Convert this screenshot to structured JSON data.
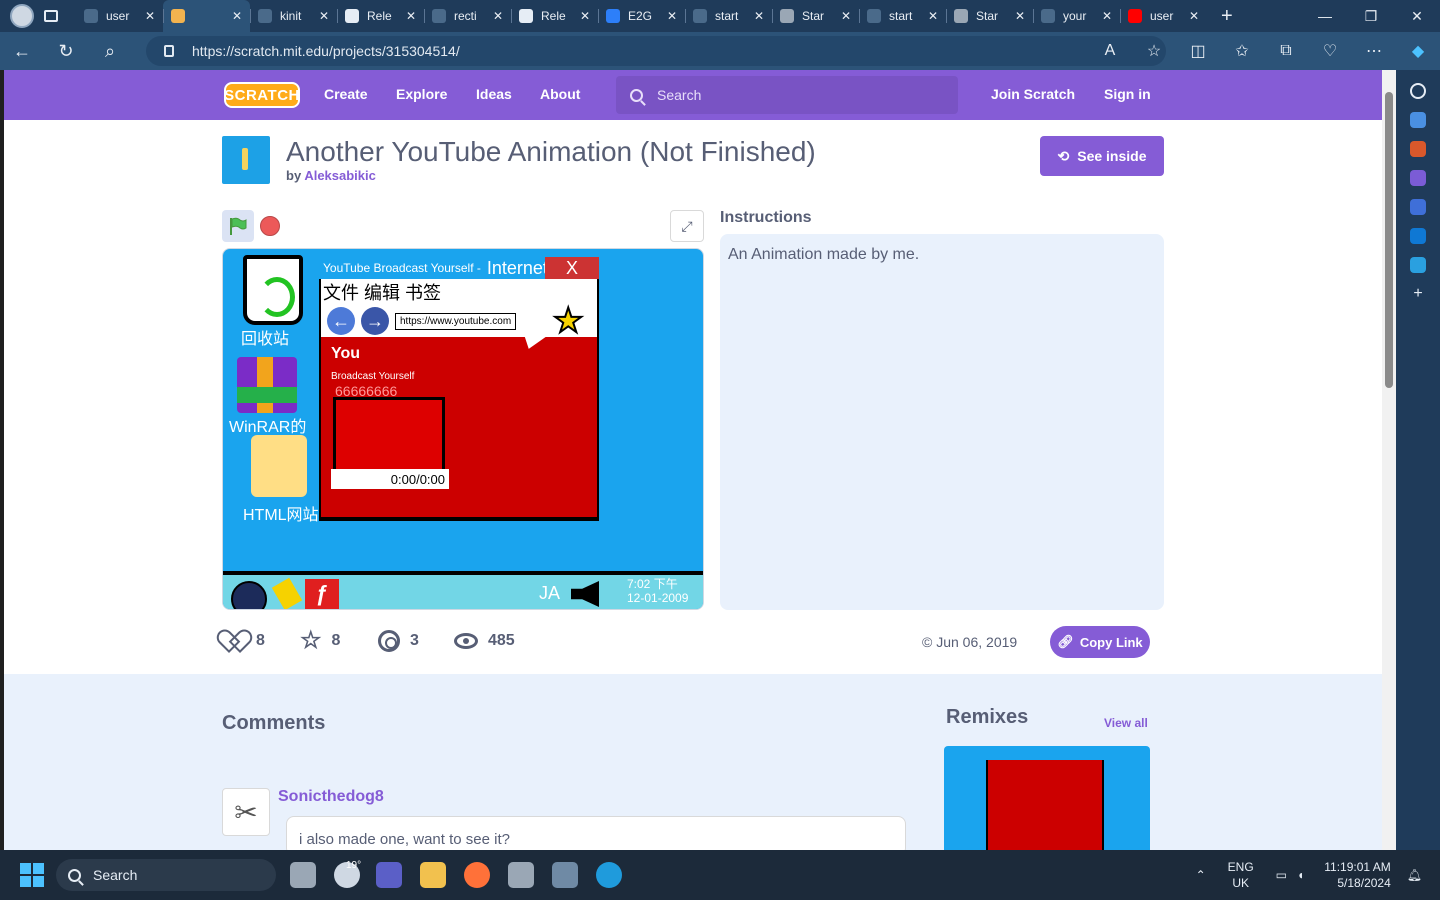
{
  "browser": {
    "tabs": [
      {
        "title": "user",
        "active": false,
        "color": "#4a6a8a"
      },
      {
        "title": "",
        "active": true,
        "color": "#f2b34f"
      },
      {
        "title": "kinit",
        "active": false,
        "color": "#4a6a8a"
      },
      {
        "title": "Rele",
        "active": false,
        "color": "#e6edf5"
      },
      {
        "title": "recti",
        "active": false,
        "color": "#4a6a8a"
      },
      {
        "title": "Rele",
        "active": false,
        "color": "#e6edf5"
      },
      {
        "title": "E2G",
        "active": false,
        "color": "#2d7ff9"
      },
      {
        "title": "start",
        "active": false,
        "color": "#4a6a8a"
      },
      {
        "title": "Star",
        "active": false,
        "color": "#9aa7b5"
      },
      {
        "title": "start",
        "active": false,
        "color": "#4a6a8a"
      },
      {
        "title": "Star",
        "active": false,
        "color": "#9aa7b5"
      },
      {
        "title": "your",
        "active": false,
        "color": "#4a6a8a"
      },
      {
        "title": "user",
        "active": false,
        "color": "#ff0000"
      }
    ],
    "url": "https://scratch.mit.edu/projects/315304514/"
  },
  "scratch_nav": {
    "logo": "SCRATCH",
    "links": [
      "Create",
      "Explore",
      "Ideas",
      "About"
    ],
    "search_placeholder": "Search",
    "join": "Join Scratch",
    "sign_in": "Sign in"
  },
  "project": {
    "title": "Another YouTube Animation (Not Finished)",
    "by_label": "by",
    "author": "Aleksabikic",
    "see_inside": "See inside",
    "instructions_title": "Instructions",
    "instructions": "An Animation made by me.",
    "stats": {
      "loves": "8",
      "favorites": "8",
      "remixes": "3",
      "views": "485"
    },
    "shared_date": "Jun 06, 2019",
    "copy_link": "Copy Link"
  },
  "stage": {
    "recycle_label": "回收站",
    "winrar_label": "WinRAR的",
    "html_label": "HTML网站",
    "window_title_small": "YouTube Broadcast Yourself -",
    "window_title_big": "Internet...",
    "window_close": "X",
    "menu": "文件 编辑  书签",
    "address": "https://www.youtube.com",
    "yt_text": "You",
    "yt_sub": "Broadcast Yourself",
    "views_text": "66666666",
    "player_time": "0:00/0:00",
    "lang": "JA",
    "clock_time": "7:02 下午",
    "clock_date": "12-01-2009"
  },
  "comments": {
    "title": "Comments",
    "items": [
      {
        "user": "Sonicthedog8",
        "text": "i also made one, want to see it?"
      }
    ]
  },
  "remixes": {
    "title": "Remixes",
    "view_all": "View all"
  },
  "os_taskbar": {
    "search": "Search",
    "weather_temp": "19°",
    "lang_top": "ENG",
    "lang_bottom": "UK",
    "time": "11:19:01 AM",
    "date": "5/18/2024"
  }
}
